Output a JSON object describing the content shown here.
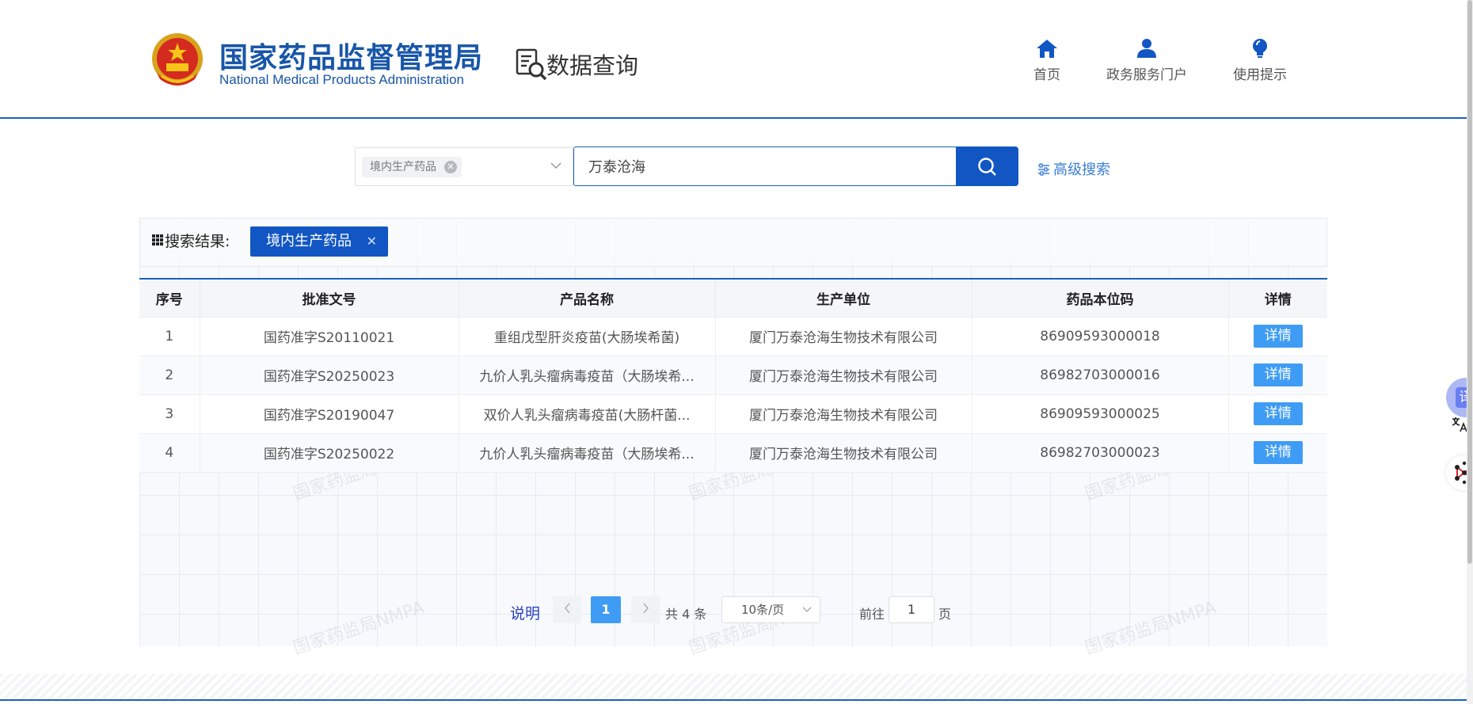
{
  "header": {
    "logo_cn": "国家药品监督管理局",
    "logo_en": "National Medical Products Administration",
    "section_title": "数据查询",
    "nav": [
      {
        "label": "首页",
        "icon": "home-icon"
      },
      {
        "label": "政务服务门户",
        "icon": "user-icon"
      },
      {
        "label": "使用提示",
        "icon": "lightbulb-icon"
      }
    ]
  },
  "search": {
    "category_tag": "境内生产药品",
    "query": "万泰沧海",
    "advanced_label": "高级搜索"
  },
  "results": {
    "label": "搜索结果:",
    "filter_tag": "境内生产药品",
    "columns": [
      "序号",
      "批准文号",
      "产品名称",
      "生产单位",
      "药品本位码",
      "详情"
    ],
    "rows": [
      {
        "no": "1",
        "approval": "国药准字S20110021",
        "product": "重组戊型肝炎疫苗(大肠埃希菌)",
        "maker": "厦门万泰沧海生物技术有限公司",
        "code": "86909593000018",
        "detail": "详情"
      },
      {
        "no": "2",
        "approval": "国药准字S20250023",
        "product": "九价人乳头瘤病毒疫苗（大肠埃希...",
        "maker": "厦门万泰沧海生物技术有限公司",
        "code": "86982703000016",
        "detail": "详情"
      },
      {
        "no": "3",
        "approval": "国药准字S20190047",
        "product": "双价人乳头瘤病毒疫苗(大肠杆菌...",
        "maker": "厦门万泰沧海生物技术有限公司",
        "code": "86909593000025",
        "detail": "详情"
      },
      {
        "no": "4",
        "approval": "国药准字S20250022",
        "product": "九价人乳头瘤病毒疫苗（大肠埃希...",
        "maker": "厦门万泰沧海生物技术有限公司",
        "code": "86982703000023",
        "detail": "详情"
      }
    ]
  },
  "pagination": {
    "note": "说明",
    "current_page": "1",
    "total": "共 4 条",
    "page_size": "10条/页",
    "goto_label": "前往",
    "goto_value": "1",
    "page_unit": "页"
  },
  "floating": {
    "translate_label": "译"
  },
  "colors": {
    "brand": "#1a62b8",
    "button": "#1256c4",
    "detail_button": "#3f9cf4"
  }
}
